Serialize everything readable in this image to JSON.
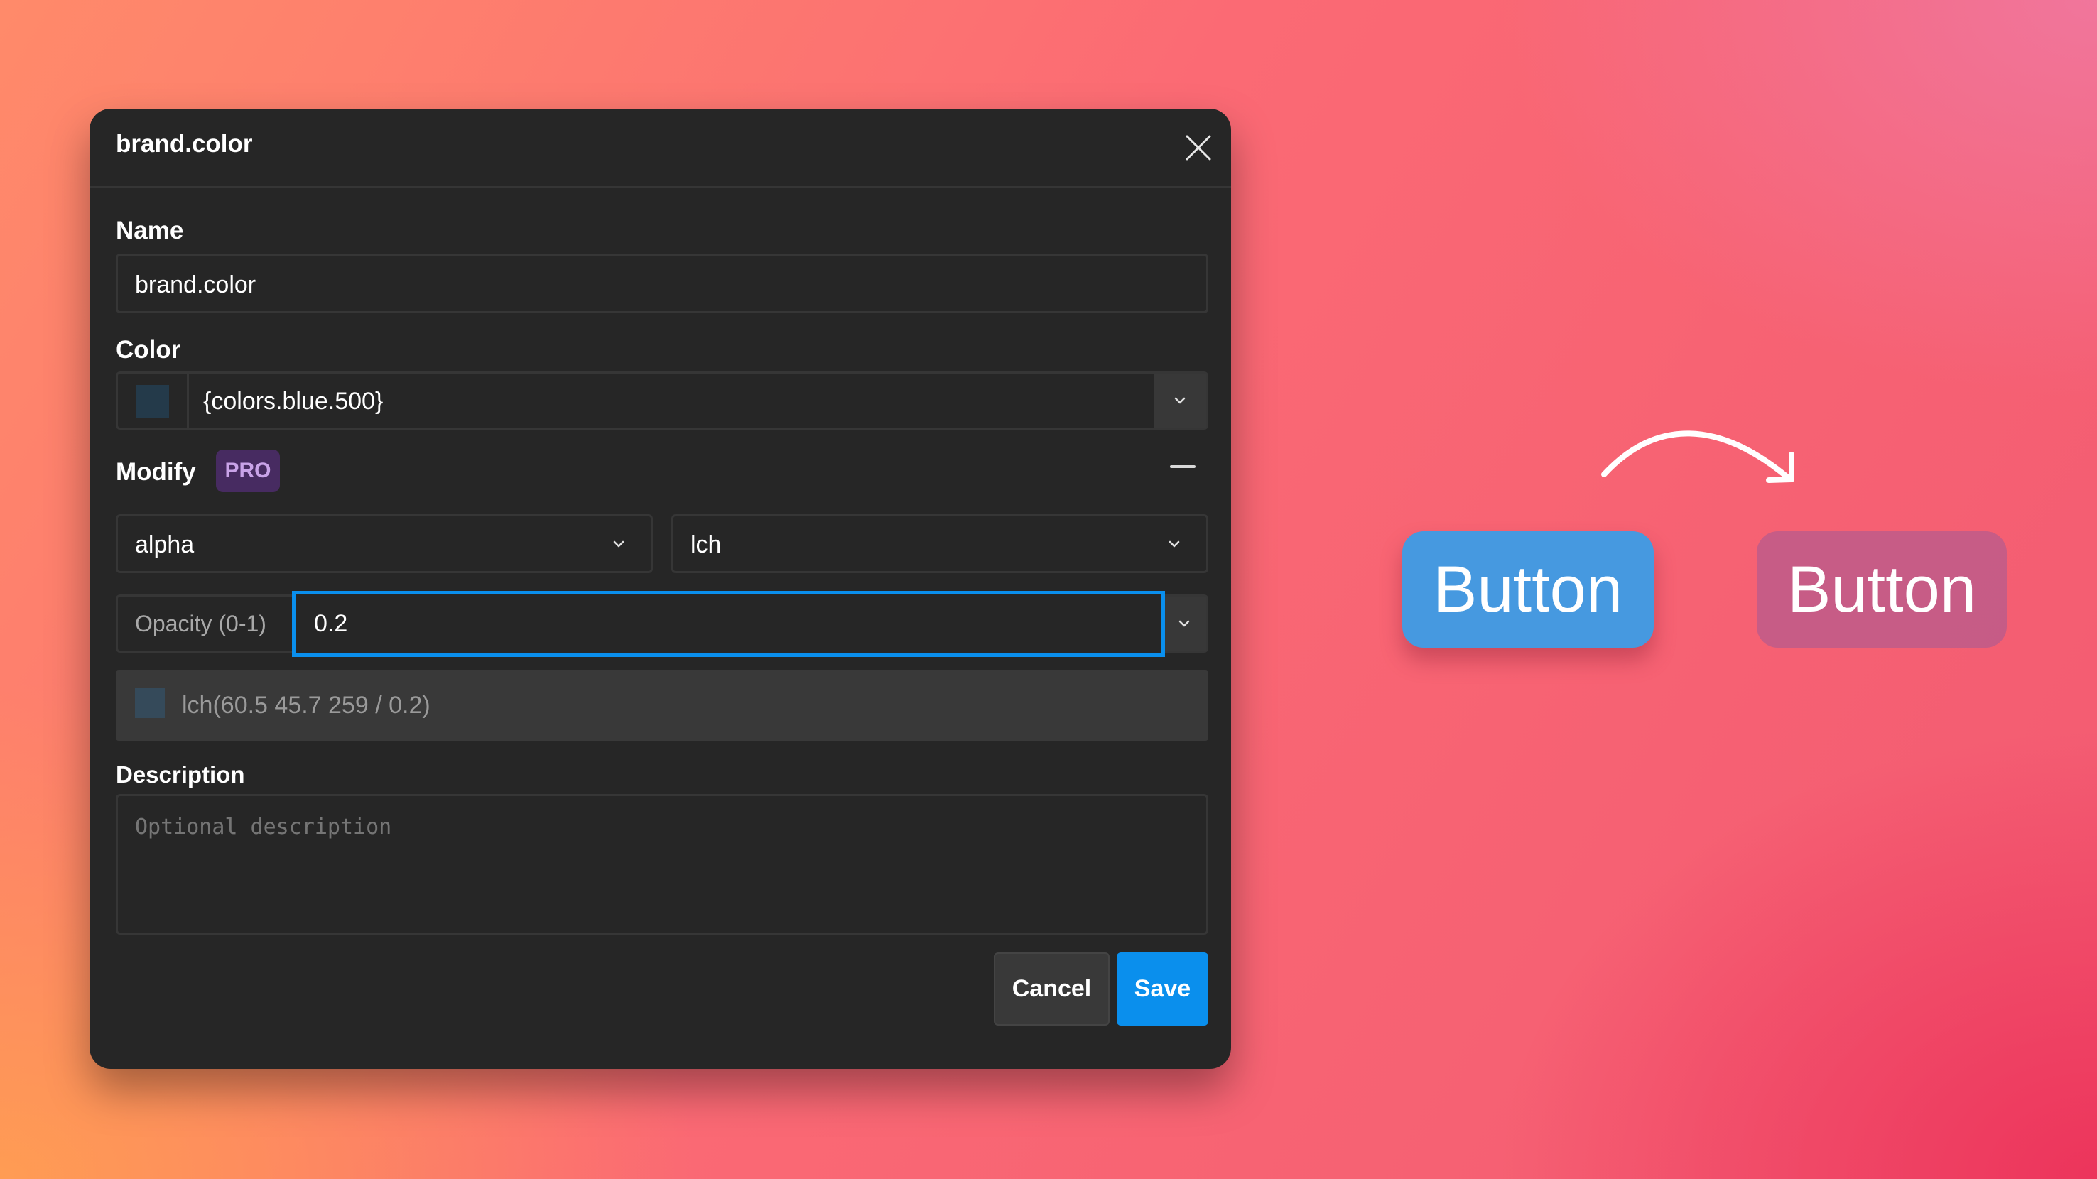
{
  "dialog": {
    "title": "brand.color",
    "close_icon": "close-icon",
    "name": {
      "label": "Name",
      "value": "brand.color"
    },
    "color": {
      "label": "Color",
      "value": "{colors.blue.500}",
      "swatch": "#243a4a",
      "dropdown_icon": "chevron-down-icon"
    },
    "modify": {
      "label": "Modify",
      "badge": "PRO",
      "collapse_icon": "minus-icon",
      "type_select": {
        "value": "alpha"
      },
      "space_select": {
        "value": "lch"
      },
      "opacity": {
        "label": "Opacity (0-1)",
        "value": "0.2"
      },
      "preview": {
        "value": "lch(60.5 45.7 259 / 0.2)",
        "swatch": "#354a5a"
      }
    },
    "description": {
      "label": "Description",
      "placeholder": "Optional description",
      "value": ""
    },
    "buttons": {
      "cancel": "Cancel",
      "save": "Save"
    },
    "accent": "#0a8fed"
  },
  "demo": {
    "before_button": {
      "label": "Button",
      "color": "#4699e0"
    },
    "after_button": {
      "label": "Button",
      "color": "#c56a88"
    },
    "arrow_icon": "curved-arrow-icon"
  }
}
